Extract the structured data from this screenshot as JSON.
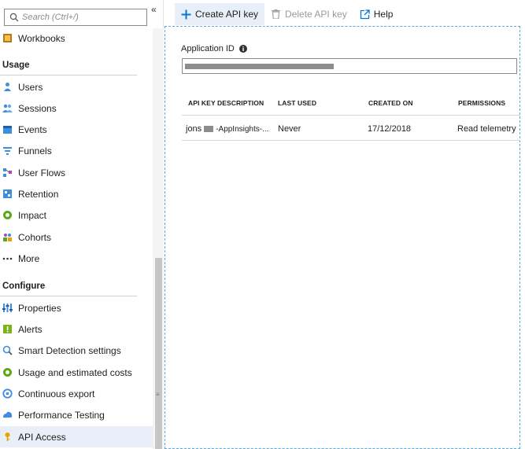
{
  "search": {
    "placeholder": "Search (Ctrl+/)"
  },
  "sidebar": {
    "collapse_glyph": "«",
    "top_items": [
      {
        "label": "Workbooks",
        "icon": "workbooks-icon"
      }
    ],
    "sections": [
      {
        "title": "Usage",
        "items": [
          {
            "label": "Users",
            "icon": "users-icon"
          },
          {
            "label": "Sessions",
            "icon": "sessions-icon"
          },
          {
            "label": "Events",
            "icon": "events-icon"
          },
          {
            "label": "Funnels",
            "icon": "funnels-icon"
          },
          {
            "label": "User Flows",
            "icon": "user-flows-icon"
          },
          {
            "label": "Retention",
            "icon": "retention-icon"
          },
          {
            "label": "Impact",
            "icon": "impact-icon"
          },
          {
            "label": "Cohorts",
            "icon": "cohorts-icon"
          },
          {
            "label": "More",
            "icon": "more-icon"
          }
        ]
      },
      {
        "title": "Configure",
        "items": [
          {
            "label": "Properties",
            "icon": "properties-icon"
          },
          {
            "label": "Alerts",
            "icon": "alerts-icon"
          },
          {
            "label": "Smart Detection settings",
            "icon": "smart-detection-icon"
          },
          {
            "label": "Usage and estimated costs",
            "icon": "usage-costs-icon"
          },
          {
            "label": "Continuous export",
            "icon": "continuous-export-icon"
          },
          {
            "label": "Performance Testing",
            "icon": "performance-testing-icon"
          },
          {
            "label": "API Access",
            "icon": "api-access-icon",
            "active": true
          }
        ]
      }
    ]
  },
  "toolbar": {
    "create_label": "Create API key",
    "delete_label": "Delete API key",
    "help_label": "Help"
  },
  "app_id": {
    "label": "Application ID",
    "value": ""
  },
  "table": {
    "headers": [
      "API KEY DESCRIPTION",
      "LAST USED",
      "CREATED ON",
      "PERMISSIONS"
    ],
    "rows": [
      {
        "description_prefix": "jons",
        "description_suffix": "-AppInsights-...",
        "last_used": "Never",
        "created_on": "17/12/2018",
        "permissions": "Read telemetry"
      }
    ]
  },
  "colors": {
    "accent": "#0078d4",
    "active_bg": "#e8eff8",
    "focus_outline": "#5aa8dc"
  }
}
